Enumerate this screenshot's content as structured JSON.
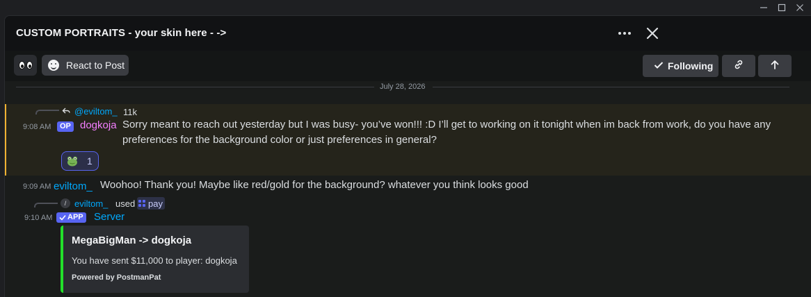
{
  "window": {
    "minimize_icon": "minimize-icon",
    "maximize_icon": "maximize-icon",
    "close_icon": "close-icon"
  },
  "header": {
    "title": "CUSTOM PORTRAITS - your skin here - ->"
  },
  "toolbar": {
    "react_label": "React to Post",
    "following_label": "Following"
  },
  "divider": {
    "date": "July 28, 2026"
  },
  "messages": [
    {
      "reply_user": "@eviltom_",
      "reply_text": "11k",
      "time": "9:08 AM",
      "badge": "OP",
      "author": "dogkoja",
      "author_color": "#f47fff",
      "text": "Sorry meant to reach out yesterday but I was busy- you’ve won!!! :D I’ll get to working on it tonight when im back from work, do you have any preferences for the background color or just preferences in general?",
      "reaction_count": "1"
    },
    {
      "time": "9:09 AM",
      "author": "eviltom_",
      "author_color": "#00a8fc",
      "text": "Woohoo! Thank you! Maybe like red/gold for the background? whatever you think looks good"
    },
    {
      "cmd_user": "eviltom_",
      "cmd_used": "used",
      "cmd_name": "pay",
      "time": "9:10 AM",
      "badge": "APP",
      "author": "Server",
      "author_color": "#00a8fc",
      "embed": {
        "title": "MegaBigMan -> dogkoja",
        "description": "You have sent $11,000 to player: dogkoja",
        "footer": "Powered by PostmanPat",
        "accent": "#23e02a"
      }
    }
  ]
}
